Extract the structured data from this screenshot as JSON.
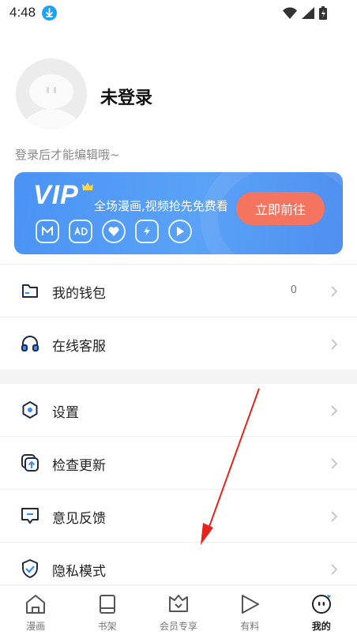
{
  "status_bar": {
    "time": "4:48"
  },
  "profile": {
    "username": "未登录",
    "hint": "登录后才能编辑哦~"
  },
  "vip": {
    "title": "VIP",
    "description": "全场漫画,视频抢先免费看",
    "button_label": "立即前往",
    "accent_color": "#4a93f4",
    "button_color": "#f47460"
  },
  "menu_group_1": [
    {
      "label": "我的钱包",
      "value": "0",
      "icon": "wallet-icon"
    },
    {
      "label": "在线客服",
      "value": "",
      "icon": "headset-icon"
    }
  ],
  "menu_group_2": [
    {
      "label": "设置",
      "icon": "settings-icon"
    },
    {
      "label": "检查更新",
      "icon": "update-icon"
    },
    {
      "label": "意见反馈",
      "icon": "feedback-icon"
    },
    {
      "label": "隐私模式",
      "icon": "privacy-shield-icon"
    }
  ],
  "tabbar": {
    "tabs": [
      {
        "label": "漫画",
        "icon": "home-icon",
        "active": false
      },
      {
        "label": "书架",
        "icon": "bookshelf-icon",
        "active": false
      },
      {
        "label": "会员专享",
        "icon": "vip-crown-icon",
        "active": false
      },
      {
        "label": "有料",
        "icon": "play-icon",
        "active": false
      },
      {
        "label": "我的",
        "icon": "profile-face-icon",
        "active": true
      }
    ]
  }
}
